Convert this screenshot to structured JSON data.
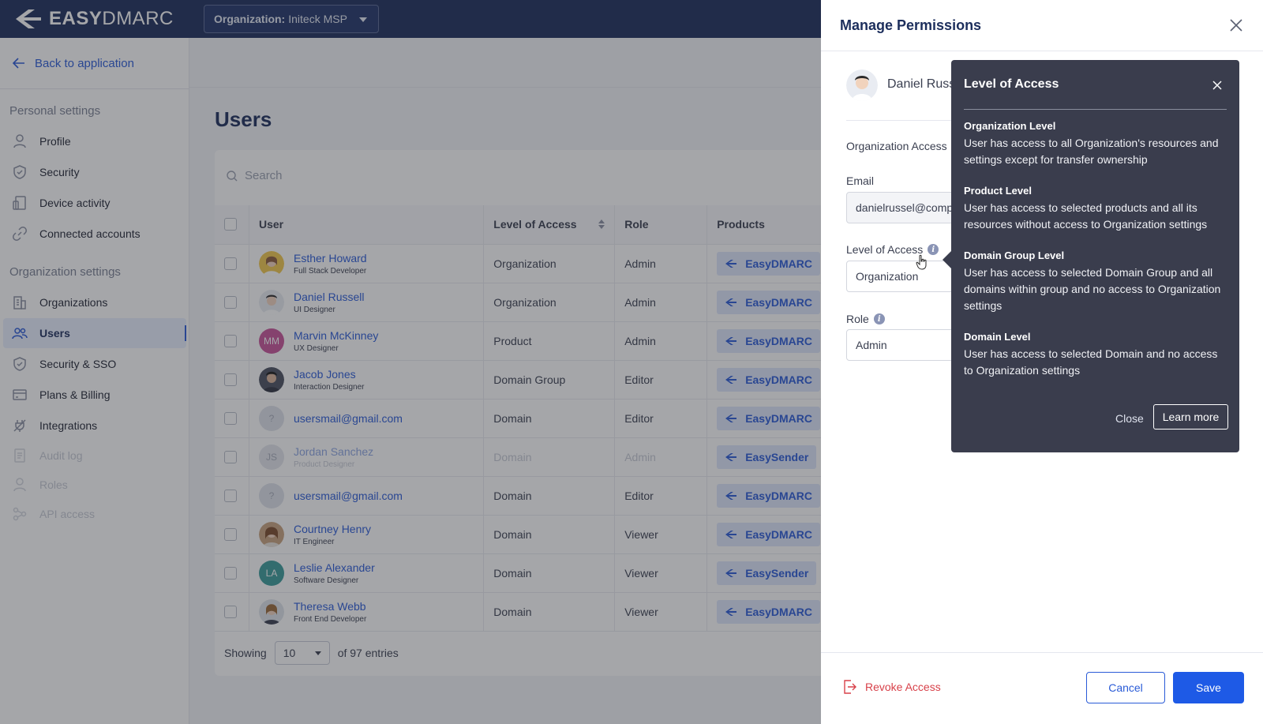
{
  "header": {
    "logo_bold": "EASY",
    "logo_light": "DMARC",
    "org_label": "Organization:",
    "org_value": "Initeck MSP"
  },
  "sidebar": {
    "back": "Back to application",
    "personal_title": "Personal settings",
    "personal_items": [
      {
        "label": "Profile",
        "icon": "user-icon"
      },
      {
        "label": "Security",
        "icon": "shield-icon"
      },
      {
        "label": "Device activity",
        "icon": "device-icon"
      },
      {
        "label": "Connected accounts",
        "icon": "link-icon"
      }
    ],
    "org_title": "Organization settings",
    "org_items": [
      {
        "label": "Organizations",
        "icon": "building-icon"
      },
      {
        "label": "Users",
        "icon": "users-icon",
        "active": true
      },
      {
        "label": "Security & SSO",
        "icon": "shield-icon"
      },
      {
        "label": "Plans & Billing",
        "icon": "card-icon"
      },
      {
        "label": "Integrations",
        "icon": "plug-icon"
      },
      {
        "label": "Audit log",
        "icon": "log-icon",
        "disabled": true
      },
      {
        "label": "Roles",
        "icon": "user-icon",
        "disabled": true
      },
      {
        "label": "API access",
        "icon": "api-icon",
        "disabled": true
      }
    ]
  },
  "main": {
    "title": "Users",
    "search_placeholder": "Search",
    "columns": [
      "User",
      "Level of Access",
      "Role",
      "Products"
    ],
    "rows": [
      {
        "name": "Esther Howard",
        "title": "Full Stack Developer",
        "access": "Organization",
        "role": "Admin",
        "product": "EasyDMARC",
        "avatar": "photo-1"
      },
      {
        "name": "Daniel Russell",
        "title": "UI Designer",
        "access": "Organization",
        "role": "Admin",
        "product": "EasyDMARC",
        "avatar": "photo-2"
      },
      {
        "name": "Marvin McKinney",
        "title": "UX Designer",
        "access": "Product",
        "role": "Admin",
        "product": "EasyDMARC",
        "initials": "MM",
        "color": "#c8549a"
      },
      {
        "name": "Jacob Jones",
        "title": "Interaction Designer",
        "access": "Domain Group",
        "role": "Editor",
        "product": "EasyDMARC",
        "avatar": "photo-3"
      },
      {
        "name": "usersmail@gmail.com",
        "title": "",
        "access": "Domain",
        "role": "Editor",
        "product": "EasyDMARC",
        "initials": "?",
        "color": "#dfe2ea"
      },
      {
        "name": "Jordan Sanchez",
        "title": "Product Designer",
        "access": "Domain",
        "role": "Admin",
        "product": "EasySender",
        "initials": "JS",
        "color": "#e3e5ec",
        "faded": true
      },
      {
        "name": "usersmail@gmail.com",
        "title": "",
        "access": "Domain",
        "role": "Editor",
        "product": "EasyDMARC",
        "initials": "?",
        "color": "#dfe2ea"
      },
      {
        "name": "Courtney Henry",
        "title": "IT Engineer",
        "access": "Domain",
        "role": "Viewer",
        "product": "EasyDMARC",
        "avatar": "photo-4"
      },
      {
        "name": "Leslie Alexander",
        "title": "Software Designer",
        "access": "Domain",
        "role": "Viewer",
        "product": "EasySender",
        "initials": "LA",
        "color": "#3a9b9a"
      },
      {
        "name": "Theresa Webb",
        "title": "Front End Developer",
        "access": "Domain",
        "role": "Viewer",
        "product": "EasyDMARC",
        "avatar": "photo-5"
      }
    ],
    "showing_label": "Showing",
    "page_size": "10",
    "entries_label": "of 97 entries"
  },
  "drawer": {
    "title": "Manage Permissions",
    "user_name": "Daniel Russ",
    "org_access_label": "Organization Access",
    "email_label": "Email",
    "email_value": "danielrussel@comp",
    "loa_label": "Level of Access",
    "loa_value": "Organization",
    "role_label": "Role",
    "role_value": "Admin",
    "revoke": "Revoke Access",
    "cancel": "Cancel",
    "save": "Save"
  },
  "popover": {
    "title": "Level of Access",
    "sections": [
      {
        "heading": "Organization Level",
        "text": "User has access to all Organization's resources and settings except for transfer ownership"
      },
      {
        "heading": "Product Level",
        "text": "User has access to selected products and all its resources without access to Organization settings"
      },
      {
        "heading": "Domain Group Level",
        "text": "User has access to selected Domain Group and all domains within group and no access to Organization settings"
      },
      {
        "heading": "Domain Level",
        "text": "User has access to selected Domain and no  access to Organization settings"
      }
    ],
    "close": "Close",
    "learn_more": "Learn more"
  },
  "colors": {
    "brand_navy": "#1c2e5c",
    "accent_blue": "#1e5ae6",
    "danger": "#d8414a",
    "popover_bg": "#3a3d4d"
  }
}
